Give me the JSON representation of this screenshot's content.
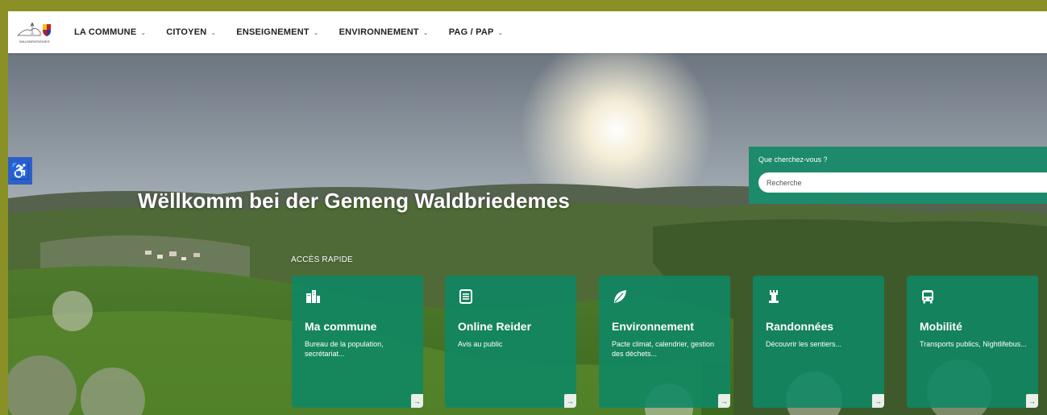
{
  "nav": {
    "logo_text": "WALDBRIEDEMES",
    "items": [
      {
        "label": "LA COMMUNE"
      },
      {
        "label": "CITOYEN"
      },
      {
        "label": "ENSEIGNEMENT"
      },
      {
        "label": "ENVIRONNEMENT"
      },
      {
        "label": "PAG / PAP"
      }
    ]
  },
  "hero": {
    "welcome": "Wëllkomm bei der Gemeng Waldbriedemes",
    "accessibility_icon": "♿"
  },
  "search": {
    "label": "Que cherchez-vous ?",
    "placeholder": "Recherche"
  },
  "quick_access": {
    "heading": "ACCÈS RAPIDE",
    "cards": [
      {
        "title": "Ma commune",
        "desc": "Bureau de la population, secrétariat...",
        "icon": "buildings-icon"
      },
      {
        "title": "Online Reider",
        "desc": "Avis au public",
        "icon": "document-icon"
      },
      {
        "title": "Environnement",
        "desc": "Pacte climat, calendrier, gestion des déchets...",
        "icon": "leaf-icon"
      },
      {
        "title": "Randonnées",
        "desc": "Découvrir les sentiers...",
        "icon": "tower-icon"
      },
      {
        "title": "Mobilité",
        "desc": "Transports publics, Nightlifebus...",
        "icon": "bus-icon"
      }
    ],
    "arrow": "→"
  },
  "colors": {
    "frame": "#8a9026",
    "accent": "#1c8a6b",
    "card": "#0e8764",
    "accessibility": "#2d5fc7"
  }
}
